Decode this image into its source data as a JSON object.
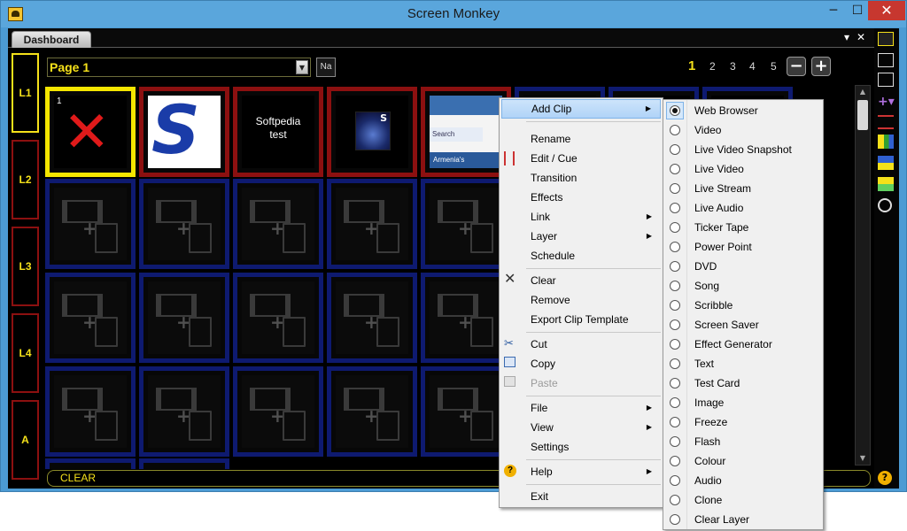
{
  "window": {
    "title": "Screen Monkey",
    "min_label": "─",
    "max_label": "☐",
    "close_label": "✕"
  },
  "tabs": {
    "dashboard": "Dashboard",
    "dropdown_glyph": "▾",
    "close_glyph": "✕"
  },
  "layers": [
    "L1",
    "L2",
    "L3",
    "L4",
    "A"
  ],
  "page_selector": {
    "value": "Page 1",
    "arrow": "▼",
    "name_button": "Na"
  },
  "pages": {
    "current": "1",
    "others": [
      "2",
      "3",
      "4",
      "5"
    ],
    "minus": "−",
    "plus": "+"
  },
  "clips": {
    "first_cell_number": "1",
    "x_mark": "✕",
    "logo_letter": "S",
    "text_clip": "Softpedia\ntest",
    "image_letter": "S",
    "web_search": "Search",
    "web_footer": "Armenia's"
  },
  "clear_bar": "CLEAR",
  "help_glyph": "?",
  "context_menu": {
    "items": [
      {
        "label": "Add Clip",
        "submenu": true,
        "highlighted": true
      },
      {
        "label": "Rename"
      },
      {
        "label": "Edit / Cue"
      },
      {
        "label": "Transition"
      },
      {
        "label": "Effects"
      },
      {
        "label": "Link",
        "submenu": true
      },
      {
        "label": "Layer",
        "submenu": true
      },
      {
        "label": "Schedule"
      },
      {
        "label": "Clear"
      },
      {
        "label": "Remove"
      },
      {
        "label": "Export Clip Template"
      },
      {
        "label": "Cut"
      },
      {
        "label": "Copy"
      },
      {
        "label": "Paste",
        "disabled": true
      },
      {
        "label": "File",
        "submenu": true
      },
      {
        "label": "View",
        "submenu": true
      },
      {
        "label": "Settings"
      },
      {
        "label": "Help",
        "submenu": true
      },
      {
        "label": "Exit"
      }
    ],
    "submenu_arrow": "▶"
  },
  "add_clip_submenu": {
    "items": [
      "Web Browser",
      "Video",
      "Live Video Snapshot",
      "Live Video",
      "Live Stream",
      "Live Audio",
      "Ticker Tape",
      "Power Point",
      "DVD",
      "Song",
      "Scribble",
      "Screen Saver",
      "Effect Generator",
      "Text",
      "Test Card",
      "Image",
      "Freeze",
      "Flash",
      "Colour",
      "Audio",
      "Clone",
      "Clear Layer"
    ],
    "selected": "Web Browser"
  }
}
